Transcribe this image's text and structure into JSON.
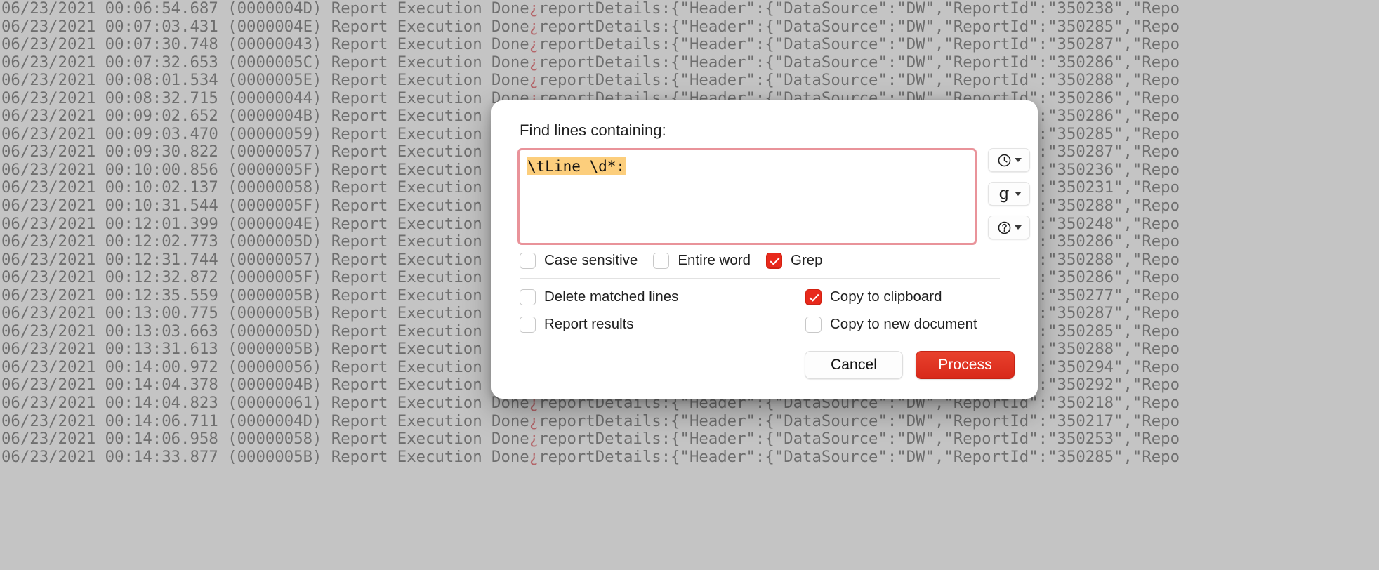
{
  "background": {
    "type": "log-viewer",
    "font": "monospace",
    "line_template": "{date} {time} ({thread}) Report Execution Done¿reportDetails:{\"Header\":{\"DataSource\":\"DW\",\"ReportId\":\"{report_id}\",\"Repo",
    "date": "06/23/2021",
    "message": "Report Execution Done",
    "control_char": "¿",
    "details_prefix": "reportDetails:{\"Header\":{\"DataSource\":\"DW\",\"ReportId\":\"",
    "details_suffix": "\",\"Repo",
    "lines": [
      {
        "time": "00:06:54.687",
        "thread": "0000004D",
        "report_id": "350238"
      },
      {
        "time": "00:07:03.431",
        "thread": "0000004E",
        "report_id": "350285"
      },
      {
        "time": "00:07:30.748",
        "thread": "00000043",
        "report_id": "350287"
      },
      {
        "time": "00:07:32.653",
        "thread": "0000005C",
        "report_id": "350286"
      },
      {
        "time": "00:08:01.534",
        "thread": "0000005E",
        "report_id": "350288"
      },
      {
        "time": "00:08:32.715",
        "thread": "00000044",
        "report_id": "350286"
      },
      {
        "time": "00:09:02.652",
        "thread": "0000004B",
        "report_id": "350286"
      },
      {
        "time": "00:09:03.470",
        "thread": "00000059",
        "report_id": "350285"
      },
      {
        "time": "00:09:30.822",
        "thread": "00000057",
        "report_id": "350287"
      },
      {
        "time": "00:10:00.856",
        "thread": "0000005F",
        "report_id": "350236"
      },
      {
        "time": "00:10:02.137",
        "thread": "00000058",
        "report_id": "350231"
      },
      {
        "time": "00:10:31.544",
        "thread": "0000005F",
        "report_id": "350288"
      },
      {
        "time": "00:12:01.399",
        "thread": "0000004E",
        "report_id": "350248"
      },
      {
        "time": "00:12:02.773",
        "thread": "0000005D",
        "report_id": "350286"
      },
      {
        "time": "00:12:31.744",
        "thread": "00000057",
        "report_id": "350288"
      },
      {
        "time": "00:12:32.872",
        "thread": "0000005F",
        "report_id": "350286"
      },
      {
        "time": "00:12:35.559",
        "thread": "0000005B",
        "report_id": "350277"
      },
      {
        "time": "00:13:00.775",
        "thread": "0000005B",
        "report_id": "350287"
      },
      {
        "time": "00:13:03.663",
        "thread": "0000005D",
        "report_id": "350285"
      },
      {
        "time": "00:13:31.613",
        "thread": "0000005B",
        "report_id": "350288"
      },
      {
        "time": "00:14:00.972",
        "thread": "00000056",
        "report_id": "350294"
      },
      {
        "time": "00:14:04.378",
        "thread": "0000004B",
        "report_id": "350292"
      },
      {
        "time": "00:14:04.823",
        "thread": "00000061",
        "report_id": "350218"
      },
      {
        "time": "00:14:06.711",
        "thread": "0000004D",
        "report_id": "350217"
      },
      {
        "time": "00:14:06.958",
        "thread": "00000058",
        "report_id": "350253"
      },
      {
        "time": "00:14:33.877",
        "thread": "0000005B",
        "report_id": "350285"
      }
    ]
  },
  "dialog": {
    "title": "Find lines containing:",
    "search": {
      "value": "\\tLine \\d*:",
      "highlight_color": "#fcce7c",
      "border_color": "#e9939a"
    },
    "side_buttons": [
      {
        "name": "history",
        "icon": "clock-icon",
        "glyph": "▼"
      },
      {
        "name": "grep-presets",
        "icon": "g-letter-icon",
        "label": "g"
      },
      {
        "name": "help",
        "icon": "question-mark-icon",
        "glyph": "▼"
      }
    ],
    "options_top": [
      {
        "label": "Case sensitive",
        "checked": false
      },
      {
        "label": "Entire word",
        "checked": false
      },
      {
        "label": "Grep",
        "checked": true
      }
    ],
    "options_grid": [
      {
        "label": "Delete matched lines",
        "checked": false
      },
      {
        "label": "Copy to clipboard",
        "checked": true
      },
      {
        "label": "Report results",
        "checked": false
      },
      {
        "label": "Copy to new document",
        "checked": false
      }
    ],
    "buttons": {
      "cancel": "Cancel",
      "process": "Process"
    },
    "accent_color": "#e8291c"
  }
}
